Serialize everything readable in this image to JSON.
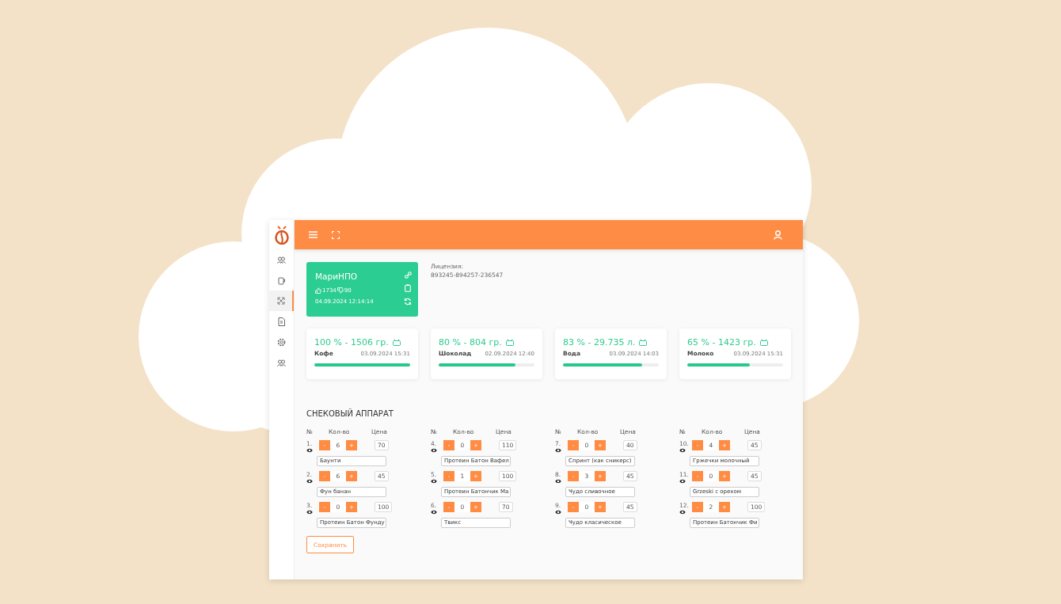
{
  "sidebar": {
    "items": [
      {
        "selected": false
      },
      {
        "selected": false
      },
      {
        "selected": true
      },
      {
        "selected": false
      },
      {
        "selected": false
      },
      {
        "selected": false
      }
    ]
  },
  "company": {
    "name": "МариНПО",
    "likes": "1734",
    "dislikes": "90",
    "date": "04.09.2024 12:14:14"
  },
  "license": {
    "label": "Лицензия:",
    "value": "893245-894257-236547"
  },
  "tanks": [
    {
      "reading": "100 % - 1506 гр.",
      "name": "Кофе",
      "date": "03.09.2024 15:31",
      "level": 1.0
    },
    {
      "reading": "80 % - 804 гр.",
      "name": "Шоколад",
      "date": "02.09.2024 12:40",
      "level": 0.8
    },
    {
      "reading": "83 % - 29.735 л.",
      "name": "Вода",
      "date": "03.09.2024 14:03",
      "level": 0.83
    },
    {
      "reading": "65 % - 1423 гр.",
      "name": "Молоко",
      "date": "03.09.2024 15:31",
      "level": 0.65
    }
  ],
  "section_title": "СНЕКОВЫЙ АППАРАТ",
  "columns": [
    {
      "headers": [
        "№",
        "Кол-во",
        "Цена"
      ],
      "items": [
        {
          "number": "1.",
          "qty": "6",
          "price": "70",
          "name": "Баунти"
        },
        {
          "number": "2.",
          "qty": "6",
          "price": "45",
          "name": "Фун банан"
        },
        {
          "number": "3.",
          "qty": "0",
          "price": "100",
          "name": "Протеин Батон Фунду"
        }
      ]
    },
    {
      "headers": [
        "№",
        "Кол-во",
        "Цена"
      ],
      "items": [
        {
          "number": "4.",
          "qty": "0",
          "price": "110",
          "name": "Протеин Батон Вафел"
        },
        {
          "number": "5.",
          "qty": "1",
          "price": "100",
          "name": "Протеин Батончик Ма"
        },
        {
          "number": "6.",
          "qty": "0",
          "price": "70",
          "name": "Твикс"
        }
      ]
    },
    {
      "headers": [
        "№",
        "Кол-во",
        "Цена"
      ],
      "items": [
        {
          "number": "7.",
          "qty": "0",
          "price": "40",
          "name": "Спринт (как сникерс)"
        },
        {
          "number": "8.",
          "qty": "3",
          "price": "45",
          "name": "Чудо сливочное"
        },
        {
          "number": "9.",
          "qty": "0",
          "price": "45",
          "name": "Чудо класическое"
        }
      ]
    },
    {
      "headers": [
        "№",
        "Кол-во",
        "Цена"
      ],
      "items": [
        {
          "number": "10.",
          "qty": "4",
          "price": "45",
          "name": "Гржечки молочный"
        },
        {
          "number": "11.",
          "qty": "0",
          "price": "45",
          "name": "Grzeski с орехом"
        },
        {
          "number": "12.",
          "qty": "2",
          "price": "100",
          "name": "Протеин Батончик Фи"
        }
      ]
    }
  ],
  "stepper": {
    "minus": "-",
    "plus": "+"
  },
  "save_button": "Сохранить"
}
